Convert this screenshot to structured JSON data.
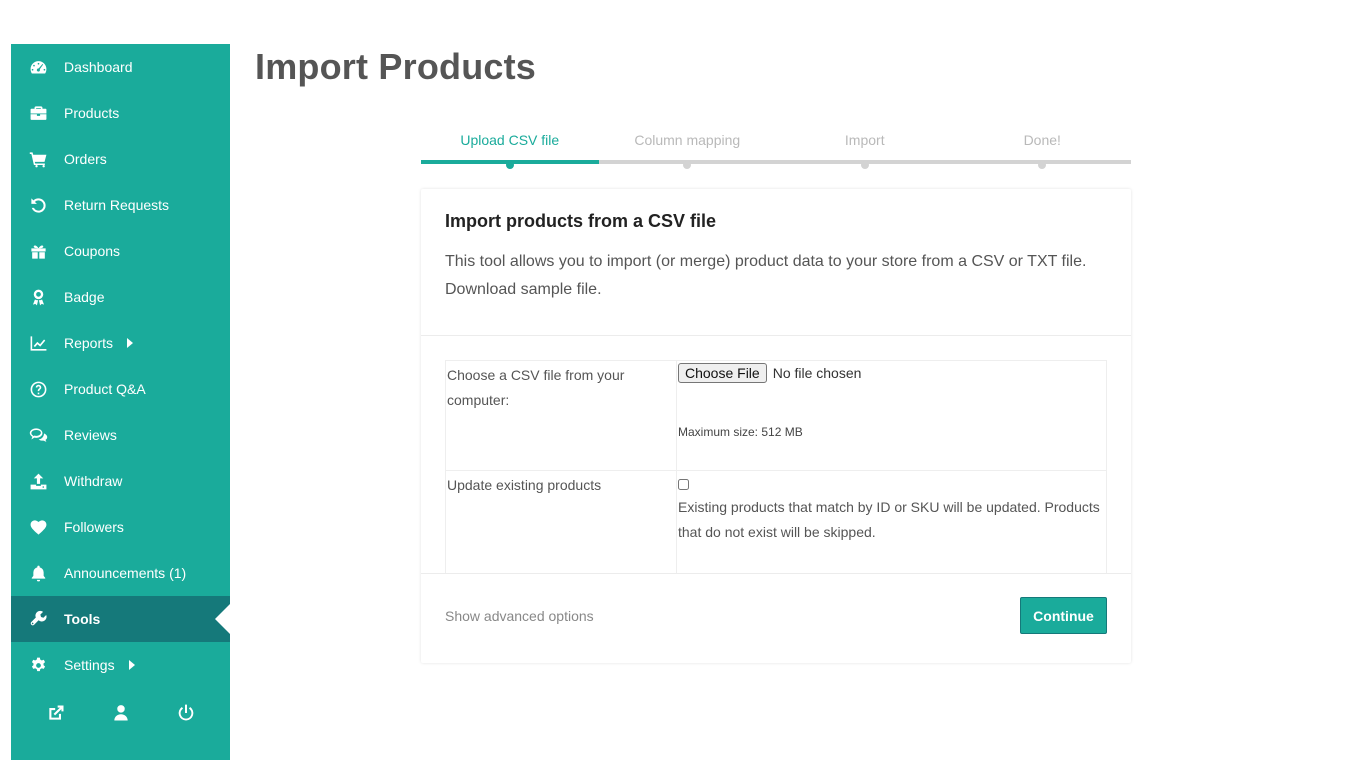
{
  "sidebar": {
    "items": [
      {
        "label": "Dashboard",
        "icon": "dashboard-icon"
      },
      {
        "label": "Products",
        "icon": "briefcase-icon"
      },
      {
        "label": "Orders",
        "icon": "cart-icon"
      },
      {
        "label": "Return Requests",
        "icon": "undo-icon"
      },
      {
        "label": "Coupons",
        "icon": "gift-icon"
      },
      {
        "label": "Badge",
        "icon": "award-icon"
      },
      {
        "label": "Reports",
        "icon": "chart-line-icon"
      },
      {
        "label": "Product Q&A",
        "icon": "question-circle-icon"
      },
      {
        "label": "Reviews",
        "icon": "comments-icon"
      },
      {
        "label": "Withdraw",
        "icon": "upload-icon"
      },
      {
        "label": "Followers",
        "icon": "heart-icon"
      },
      {
        "label": "Announcements (1)",
        "icon": "bell-icon"
      },
      {
        "label": "Tools",
        "icon": "wrench-icon",
        "active": true
      },
      {
        "label": "Settings",
        "icon": "gear-icon"
      }
    ],
    "footer_icons": [
      "external-link-icon",
      "user-icon",
      "power-icon"
    ]
  },
  "page": {
    "title": "Import Products"
  },
  "steps": [
    "Upload CSV file",
    "Column mapping",
    "Import",
    "Done!"
  ],
  "card": {
    "title": "Import products from a CSV file",
    "desc_line1": "This tool allows you to import (or merge) product data to your store from a CSV or TXT file.",
    "desc_line2": "Download sample file.",
    "file_label": "Choose a CSV file from your computer:",
    "file_button": "Choose File",
    "file_status": "No file chosen",
    "max_size": "Maximum size: 512 MB",
    "update_label": "Update existing products",
    "update_help": "Existing products that match by ID or SKU will be updated. Products that do not exist will be skipped.",
    "advanced_link": "Show advanced options",
    "continue_label": "Continue"
  },
  "colors": {
    "accent": "#1aab9b",
    "active_item": "#15797a"
  }
}
